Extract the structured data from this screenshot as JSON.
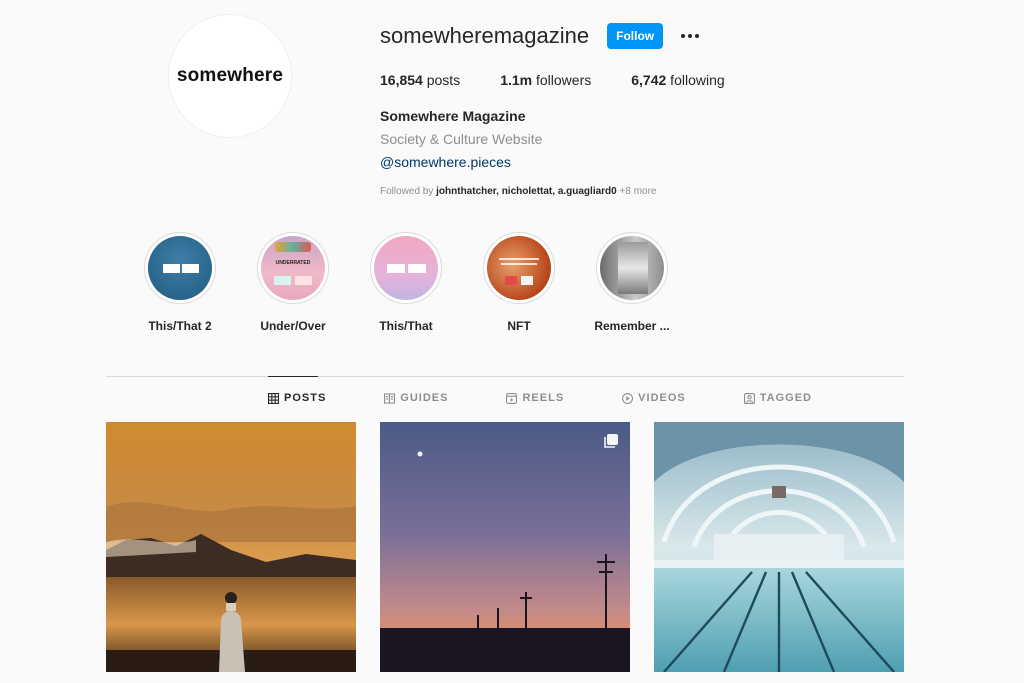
{
  "profile": {
    "avatar_text": "somewhere",
    "username": "somewheremagazine",
    "follow_label": "Follow",
    "stats": [
      {
        "count": "16,854",
        "label": " posts"
      },
      {
        "count": "1.1m",
        "label": " followers"
      },
      {
        "count": "6,742",
        "label": " following"
      }
    ],
    "full_name": "Somewhere Magazine",
    "category": "Society & Culture Website",
    "bio_link": "@somewhere.pieces",
    "followed_by_prefix": "Followed by ",
    "followed_by_users": "johnthatcher, nicholettat, a.guagliard0",
    "followed_by_more": " +8 more"
  },
  "highlights": [
    {
      "label": "This/That 2",
      "icon": "highlight-this-that-2"
    },
    {
      "label": "Under/Over",
      "icon": "highlight-under-over",
      "inner_text": "UNDERRATED"
    },
    {
      "label": "This/That",
      "icon": "highlight-this-that"
    },
    {
      "label": "NFT",
      "icon": "highlight-nft"
    },
    {
      "label": "Remember ...",
      "icon": "highlight-remember"
    }
  ],
  "tabs": [
    {
      "label": "POSTS",
      "icon": "grid-icon",
      "active": true
    },
    {
      "label": "GUIDES",
      "icon": "guides-icon",
      "active": false
    },
    {
      "label": "REELS",
      "icon": "reels-icon",
      "active": false
    },
    {
      "label": "VIDEOS",
      "icon": "play-icon",
      "active": false
    },
    {
      "label": "TAGGED",
      "icon": "tag-icon",
      "active": false
    }
  ],
  "posts": [
    {
      "subject": "person on shore at sunset with mountains",
      "multi_image": false
    },
    {
      "subject": "dusk sky with moon and power poles",
      "multi_image": true
    },
    {
      "subject": "arched indoor swimming pool",
      "multi_image": false
    }
  ],
  "colors": {
    "accent": "#0095f6",
    "link": "#00376b",
    "secondary_text": "#8e8e8e",
    "background": "#fafafa"
  }
}
